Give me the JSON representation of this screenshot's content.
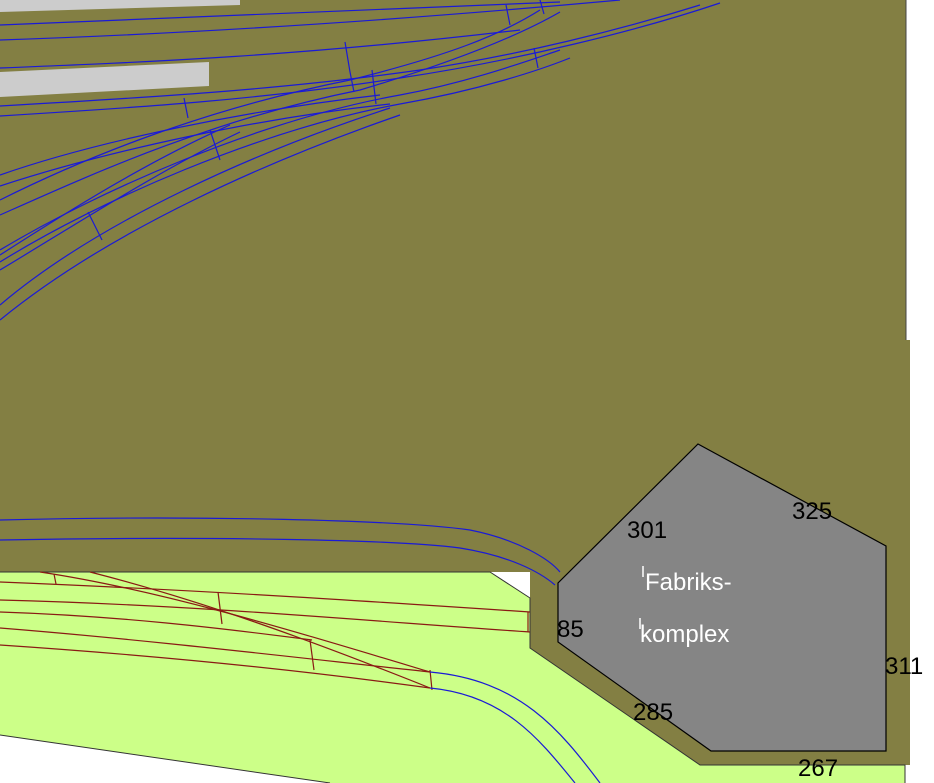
{
  "colors": {
    "upper_board": "#837f43",
    "lower_board": "#ccff88",
    "building": "#858585",
    "platform": "#cccccc",
    "upper_track": "#1a1ad6",
    "lower_track": "#8a1a14",
    "background": "#ffffff"
  },
  "building": {
    "label_line1": "Fabriks-",
    "label_line2": "komplex"
  },
  "dimensions": [
    "301",
    "325",
    "85",
    "311",
    "285",
    "267"
  ]
}
